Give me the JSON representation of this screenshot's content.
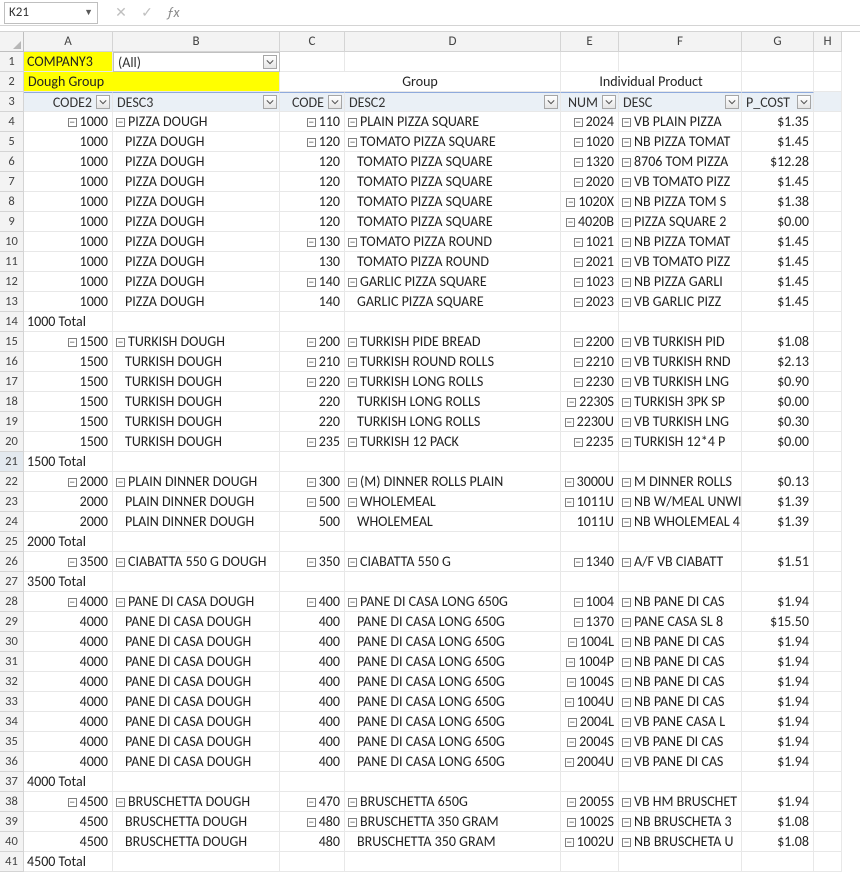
{
  "namebox": {
    "value": "K21"
  },
  "colHeaders": [
    "A",
    "B",
    "C",
    "D",
    "E",
    "F",
    "G",
    "H"
  ],
  "sheet": {
    "row1": {
      "a": "COMPANY3",
      "b": "(All)"
    },
    "row2": {
      "a": "Dough Group",
      "cd": "Group",
      "ef": "Individual Product"
    },
    "fields": {
      "code2": "CODE2",
      "desc3": "DESC3",
      "code": "CODE",
      "desc2": "DESC2",
      "num": "NUM",
      "desc": "DESC",
      "pcost": "P_COST"
    }
  },
  "rows": [
    {
      "r": 4,
      "code2": "1000",
      "code2_out": true,
      "desc3": "PIZZA DOUGH",
      "desc3_out": true,
      "code": "110",
      "code_out": true,
      "desc2": "PLAIN PIZZA SQUARE",
      "desc2_out": true,
      "num": "2024",
      "num_out": true,
      "desc": "VB PLAIN PIZZA",
      "desc_out": true,
      "pc": "$1.35"
    },
    {
      "r": 5,
      "code2": "1000",
      "desc3": "PIZZA DOUGH",
      "code": "120",
      "code_out": true,
      "desc2": "TOMATO PIZZA SQUARE",
      "desc2_out": true,
      "num": "1020",
      "num_out": true,
      "desc": "NB PIZZA TOMAT",
      "desc_out": true,
      "pc": "$1.45"
    },
    {
      "r": 6,
      "code2": "1000",
      "desc3": "PIZZA DOUGH",
      "code": "120",
      "desc2": "TOMATO PIZZA SQUARE",
      "num": "1320",
      "num_out": true,
      "desc": "8706 TOM PIZZA",
      "desc_out": true,
      "pc": "$12.28"
    },
    {
      "r": 7,
      "code2": "1000",
      "desc3": "PIZZA DOUGH",
      "code": "120",
      "desc2": "TOMATO PIZZA SQUARE",
      "num": "2020",
      "num_out": true,
      "desc": "VB TOMATO PIZZ",
      "desc_out": true,
      "pc": "$1.45"
    },
    {
      "r": 8,
      "code2": "1000",
      "desc3": "PIZZA DOUGH",
      "code": "120",
      "desc2": "TOMATO PIZZA SQUARE",
      "num": "1020X",
      "num_out": true,
      "desc": "NB PIZZA TOM S",
      "desc_out": true,
      "pc": "$1.38"
    },
    {
      "r": 9,
      "code2": "1000",
      "desc3": "PIZZA DOUGH",
      "code": "120",
      "desc2": "TOMATO PIZZA SQUARE",
      "num": "4020B",
      "num_out": true,
      "desc": "PIZZA SQUARE 2",
      "desc_out": true,
      "pc": "$0.00"
    },
    {
      "r": 10,
      "code2": "1000",
      "desc3": "PIZZA DOUGH",
      "code": "130",
      "code_out": true,
      "desc2": "TOMATO PIZZA ROUND",
      "desc2_out": true,
      "num": "1021",
      "num_out": true,
      "desc": "NB PIZZA TOMAT",
      "desc_out": true,
      "pc": "$1.45"
    },
    {
      "r": 11,
      "code2": "1000",
      "desc3": "PIZZA DOUGH",
      "code": "130",
      "desc2": "TOMATO PIZZA ROUND",
      "num": "2021",
      "num_out": true,
      "desc": "VB TOMATO PIZZ",
      "desc_out": true,
      "pc": "$1.45"
    },
    {
      "r": 12,
      "code2": "1000",
      "desc3": "PIZZA DOUGH",
      "code": "140",
      "code_out": true,
      "desc2": "GARLIC PIZZA SQUARE",
      "desc2_out": true,
      "num": "1023",
      "num_out": true,
      "desc": "NB PIZZA GARLI",
      "desc_out": true,
      "pc": "$1.45"
    },
    {
      "r": 13,
      "code2": "1000",
      "desc3": "PIZZA DOUGH",
      "code": "140",
      "desc2": "GARLIC PIZZA SQUARE",
      "num": "2023",
      "num_out": true,
      "desc": "VB GARLIC PIZZ",
      "desc_out": true,
      "pc": "$1.45"
    },
    {
      "r": 14,
      "total": "1000 Total"
    },
    {
      "r": 15,
      "code2": "1500",
      "code2_out": true,
      "desc3": "TURKISH DOUGH",
      "desc3_out": true,
      "code": "200",
      "code_out": true,
      "desc2": "TURKISH PIDE BREAD",
      "desc2_out": true,
      "num": "2200",
      "num_out": true,
      "desc": "VB TURKISH PID",
      "desc_out": true,
      "pc": "$1.08"
    },
    {
      "r": 16,
      "code2": "1500",
      "desc3": "TURKISH DOUGH",
      "code": "210",
      "code_out": true,
      "desc2": "TURKISH ROUND ROLLS",
      "desc2_out": true,
      "num": "2210",
      "num_out": true,
      "desc": "VB TURKISH RND",
      "desc_out": true,
      "pc": "$2.13"
    },
    {
      "r": 17,
      "code2": "1500",
      "desc3": "TURKISH DOUGH",
      "code": "220",
      "code_out": true,
      "desc2": "TURKISH LONG ROLLS",
      "desc2_out": true,
      "num": "2230",
      "num_out": true,
      "desc": "VB TURKISH LNG",
      "desc_out": true,
      "pc": "$0.90"
    },
    {
      "r": 18,
      "code2": "1500",
      "desc3": "TURKISH DOUGH",
      "code": "220",
      "desc2": "TURKISH LONG ROLLS",
      "num": "2230S",
      "num_out": true,
      "desc": "TURKISH 3PK SP",
      "desc_out": true,
      "pc": "$0.00"
    },
    {
      "r": 19,
      "code2": "1500",
      "desc3": "TURKISH DOUGH",
      "code": "220",
      "desc2": "TURKISH LONG ROLLS",
      "num": "2230U",
      "num_out": true,
      "desc": "VB TURKISH LNG",
      "desc_out": true,
      "pc": "$0.30"
    },
    {
      "r": 20,
      "code2": "1500",
      "desc3": "TURKISH DOUGH",
      "code": "235",
      "code_out": true,
      "desc2": "TURKISH 12 PACK",
      "desc2_out": true,
      "num": "2235",
      "num_out": true,
      "desc": "TURKISH 12*4 P",
      "desc_out": true,
      "pc": "$0.00"
    },
    {
      "r": 21,
      "total": "1500 Total",
      "sel": true
    },
    {
      "r": 22,
      "code2": "2000",
      "code2_out": true,
      "desc3": "PLAIN DINNER DOUGH",
      "desc3_out": true,
      "code": "300",
      "code_out": true,
      "desc2": "(M) DINNER ROLLS PLAIN",
      "desc2_out": true,
      "num": "3000U",
      "num_out": true,
      "desc": "M DINNER ROLLS",
      "desc_out": true,
      "pc": "$0.13"
    },
    {
      "r": 23,
      "code2": "2000",
      "desc3": "PLAIN DINNER DOUGH",
      "code": "500",
      "code_out": true,
      "desc2": "WHOLEMEAL",
      "desc2_out": true,
      "num": "1011U",
      "num_out": true,
      "desc": "NB W/MEAL UNWI",
      "desc_out": true,
      "pc": "$1.39"
    },
    {
      "r": 24,
      "code2": "2000",
      "desc3": "PLAIN DINNER DOUGH",
      "code": "500",
      "desc2": "WHOLEMEAL",
      "num": "1011U",
      "desc": "NB WHOLEMEAL 4",
      "desc_out": true,
      "pc": "$1.39"
    },
    {
      "r": 25,
      "total": "2000 Total"
    },
    {
      "r": 26,
      "code2": "3500",
      "code2_out": true,
      "desc3": "CIABATTA 550 G DOUGH",
      "desc3_out": true,
      "code": "350",
      "code_out": true,
      "desc2": "CIABATTA 550 G",
      "desc2_out": true,
      "num": "1340",
      "num_out": true,
      "desc": "A/F VB CIABATT",
      "desc_out": true,
      "pc": "$1.51"
    },
    {
      "r": 27,
      "total": "3500 Total"
    },
    {
      "r": 28,
      "code2": "4000",
      "code2_out": true,
      "desc3": "PANE DI CASA DOUGH",
      "desc3_out": true,
      "code": "400",
      "code_out": true,
      "desc2": "PANE DI CASA LONG 650G",
      "desc2_out": true,
      "num": "1004",
      "num_out": true,
      "desc": "NB PANE DI CAS",
      "desc_out": true,
      "pc": "$1.94"
    },
    {
      "r": 29,
      "code2": "4000",
      "desc3": "PANE DI CASA DOUGH",
      "code": "400",
      "desc2": "PANE DI CASA LONG 650G",
      "num": "1370",
      "num_out": true,
      "desc": "PANE CASA SL 8",
      "desc_out": true,
      "pc": "$15.50"
    },
    {
      "r": 30,
      "code2": "4000",
      "desc3": "PANE DI CASA DOUGH",
      "code": "400",
      "desc2": "PANE DI CASA LONG 650G",
      "num": "1004L",
      "num_out": true,
      "desc": "NB PANE DI CAS",
      "desc_out": true,
      "pc": "$1.94"
    },
    {
      "r": 31,
      "code2": "4000",
      "desc3": "PANE DI CASA DOUGH",
      "code": "400",
      "desc2": "PANE DI CASA LONG 650G",
      "num": "1004P",
      "num_out": true,
      "desc": "NB PANE DI CAS",
      "desc_out": true,
      "pc": "$1.94"
    },
    {
      "r": 32,
      "code2": "4000",
      "desc3": "PANE DI CASA DOUGH",
      "code": "400",
      "desc2": "PANE DI CASA LONG 650G",
      "num": "1004S",
      "num_out": true,
      "desc": "NB PANE DI CAS",
      "desc_out": true,
      "pc": "$1.94"
    },
    {
      "r": 33,
      "code2": "4000",
      "desc3": "PANE DI CASA DOUGH",
      "code": "400",
      "desc2": "PANE DI CASA LONG 650G",
      "num": "1004U",
      "num_out": true,
      "desc": "NB PANE DI CAS",
      "desc_out": true,
      "pc": "$1.94"
    },
    {
      "r": 34,
      "code2": "4000",
      "desc3": "PANE DI CASA DOUGH",
      "code": "400",
      "desc2": "PANE DI CASA LONG 650G",
      "num": "2004L",
      "num_out": true,
      "desc": "VB PANE CASA L",
      "desc_out": true,
      "pc": "$1.94"
    },
    {
      "r": 35,
      "code2": "4000",
      "desc3": "PANE DI CASA DOUGH",
      "code": "400",
      "desc2": "PANE DI CASA LONG 650G",
      "num": "2004S",
      "num_out": true,
      "desc": "VB PANE DI CAS",
      "desc_out": true,
      "pc": "$1.94"
    },
    {
      "r": 36,
      "code2": "4000",
      "desc3": "PANE DI CASA DOUGH",
      "code": "400",
      "desc2": "PANE DI CASA LONG 650G",
      "num": "2004U",
      "num_out": true,
      "desc": "VB PANE DI CAS",
      "desc_out": true,
      "pc": "$1.94"
    },
    {
      "r": 37,
      "total": "4000 Total"
    },
    {
      "r": 38,
      "code2": "4500",
      "code2_out": true,
      "desc3": "BRUSCHETTA DOUGH",
      "desc3_out": true,
      "code": "470",
      "code_out": true,
      "desc2": "BRUSCHETTA 650G",
      "desc2_out": true,
      "num": "2005S",
      "num_out": true,
      "desc": "VB HM BRUSCHET",
      "desc_out": true,
      "pc": "$1.94"
    },
    {
      "r": 39,
      "code2": "4500",
      "desc3": "BRUSCHETTA DOUGH",
      "code": "480",
      "code_out": true,
      "desc2": "BRUSCHETTA 350 GRAM",
      "desc2_out": true,
      "num": "1002S",
      "num_out": true,
      "desc": "NB BRUSCHETA 3",
      "desc_out": true,
      "pc": "$1.08"
    },
    {
      "r": 40,
      "code2": "4500",
      "desc3": "BRUSCHETTA DOUGH",
      "code": "480",
      "desc2": "BRUSCHETTA 350 GRAM",
      "num": "1002U",
      "num_out": true,
      "desc": "NB BRUSCHETA U",
      "desc_out": true,
      "pc": "$1.08"
    },
    {
      "r": 41,
      "total": "4500 Total"
    }
  ]
}
